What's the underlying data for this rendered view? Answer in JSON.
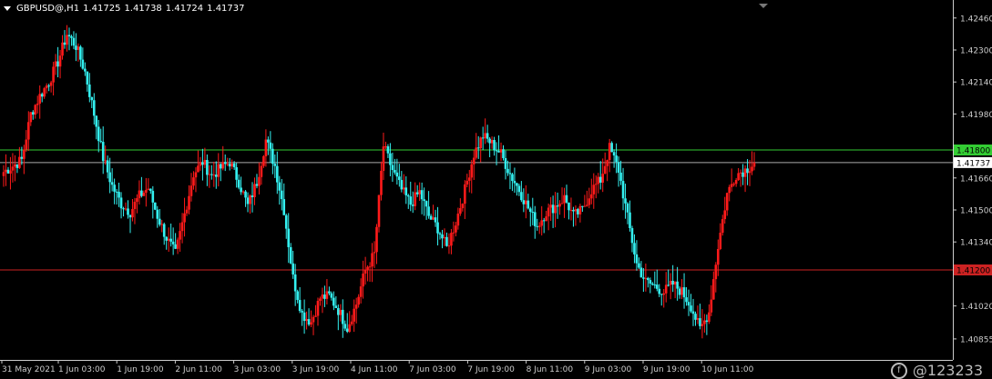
{
  "header": {
    "symbol": "GBPUSD@,H1",
    "open": "1.41725",
    "high": "1.41738",
    "low": "1.41724",
    "close": "1.41737"
  },
  "watermark": "@123233",
  "colors": {
    "background": "#000000",
    "bull": "#ff1a1a",
    "bear": "#33f0f0",
    "upper_line": "#33cc33",
    "lower_line": "#cc2222",
    "axis": "#cccccc",
    "price_line": "#aaaaaa"
  },
  "chart_data": {
    "type": "candlestick",
    "ylim": [
      1.4075,
      1.4255
    ],
    "y_ticks": [
      "1.42460",
      "1.42300",
      "1.42140",
      "1.41980",
      "1.41660",
      "1.41500",
      "1.41340",
      "1.41020",
      "1.40855"
    ],
    "x_ticks": [
      "31 May 2021",
      "1 Jun 03:00",
      "1 Jun 19:00",
      "2 Jun 11:00",
      "3 Jun 03:00",
      "3 Jun 19:00",
      "4 Jun 11:00",
      "7 Jun 03:00",
      "7 Jun 19:00",
      "8 Jun 11:00",
      "9 Jun 03:00",
      "9 Jun 19:00",
      "10 Jun 11:00"
    ],
    "levels": [
      {
        "label": "1.41800",
        "value": 1.418,
        "color": "#33cc33"
      },
      {
        "label": "1.41200",
        "value": 1.412,
        "color": "#cc2222"
      }
    ],
    "current_price": {
      "label": "1.41737",
      "value": 1.41737
    },
    "close_path": [
      1.4169,
      1.4172,
      1.4175,
      1.4198,
      1.4207,
      1.4214,
      1.4224,
      1.4238,
      1.4232,
      1.4219,
      1.4198,
      1.4176,
      1.4162,
      1.4153,
      1.4149,
      1.4157,
      1.4161,
      1.4147,
      1.4136,
      1.4128,
      1.4148,
      1.4168,
      1.4174,
      1.4167,
      1.4171,
      1.4174,
      1.4164,
      1.4152,
      1.4164,
      1.4185,
      1.4172,
      1.415,
      1.4116,
      1.4098,
      1.4094,
      1.4106,
      1.4107,
      1.41,
      1.4091,
      1.4103,
      1.412,
      1.4128,
      1.4182,
      1.417,
      1.416,
      1.4153,
      1.4159,
      1.4147,
      1.4141,
      1.4131,
      1.4144,
      1.416,
      1.4178,
      1.4187,
      1.4183,
      1.4178,
      1.4168,
      1.416,
      1.4151,
      1.4142,
      1.4149,
      1.4152,
      1.4156,
      1.4147,
      1.415,
      1.416,
      1.4165,
      1.4181,
      1.417,
      1.4146,
      1.4123,
      1.4114,
      1.4112,
      1.4109,
      1.4113,
      1.4109,
      1.4102,
      1.409,
      1.4099,
      1.4132,
      1.4158,
      1.4168,
      1.417,
      1.41737
    ]
  }
}
